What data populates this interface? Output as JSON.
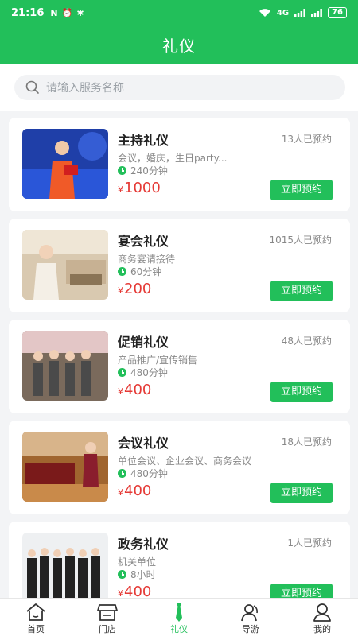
{
  "status_bar": {
    "time": "21:16",
    "left_icons": [
      "N",
      "⏰",
      "✱"
    ],
    "network": "4G",
    "battery": "76"
  },
  "header": {
    "title": "礼仪"
  },
  "search": {
    "placeholder": "请输入服务名称"
  },
  "colors": {
    "brand": "#22bf5a",
    "price": "#e53935"
  },
  "services": [
    {
      "title": "主持礼仪",
      "booked": "13人已预约",
      "desc": "会议，婚庆，生日party...",
      "duration": "240分钟",
      "currency": "¥",
      "price": "1000",
      "button": "立即预约"
    },
    {
      "title": "宴会礼仪",
      "booked": "1015人已预约",
      "desc": "商务宴请接待",
      "duration": "60分钟",
      "currency": "¥",
      "price": "200",
      "button": "立即预约"
    },
    {
      "title": "促销礼仪",
      "booked": "48人已预约",
      "desc": "产品推广/宣传销售",
      "duration": "480分钟",
      "currency": "¥",
      "price": "400",
      "button": "立即预约"
    },
    {
      "title": "会议礼仪",
      "booked": "18人已预约",
      "desc": "单位会议、企业会议、商务会议",
      "duration": "480分钟",
      "currency": "¥",
      "price": "400",
      "button": "立即预约"
    },
    {
      "title": "政务礼仪",
      "booked": "1人已预约",
      "desc": "机关单位",
      "duration": "8小时",
      "currency": "¥",
      "price": "400",
      "button": "立即预约"
    }
  ],
  "tabs": [
    {
      "label": "首页",
      "icon": "home-icon"
    },
    {
      "label": "门店",
      "icon": "store-icon"
    },
    {
      "label": "礼仪",
      "icon": "tie-icon",
      "active": true
    },
    {
      "label": "导游",
      "icon": "guide-icon"
    },
    {
      "label": "我的",
      "icon": "profile-icon"
    }
  ]
}
